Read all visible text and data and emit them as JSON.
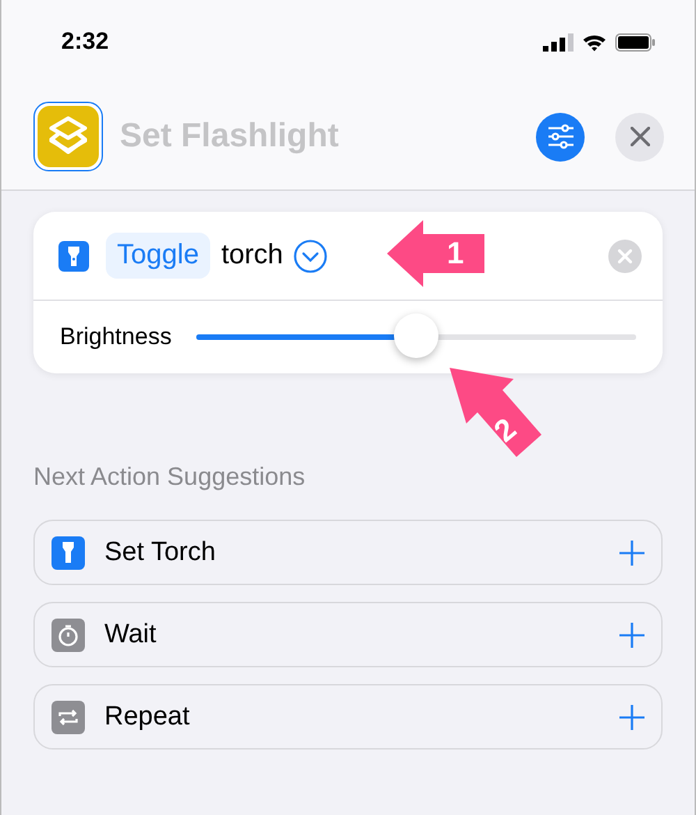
{
  "status_bar": {
    "time": "2:32"
  },
  "header": {
    "title": "Set Flashlight"
  },
  "action": {
    "parameter": "Toggle",
    "object": "torch",
    "slider": {
      "label": "Brightness",
      "level": 0.5
    }
  },
  "annotations": [
    {
      "label": "1"
    },
    {
      "label": "2"
    }
  ],
  "suggestions": {
    "title": "Next Action Suggestions",
    "items": [
      {
        "label": "Set Torch",
        "kind": "flashlight",
        "color": "#1a7cf5"
      },
      {
        "label": "Wait",
        "kind": "timer",
        "color": "#8e8e93"
      },
      {
        "label": "Repeat",
        "kind": "repeat",
        "color": "#8e8e93"
      }
    ]
  }
}
